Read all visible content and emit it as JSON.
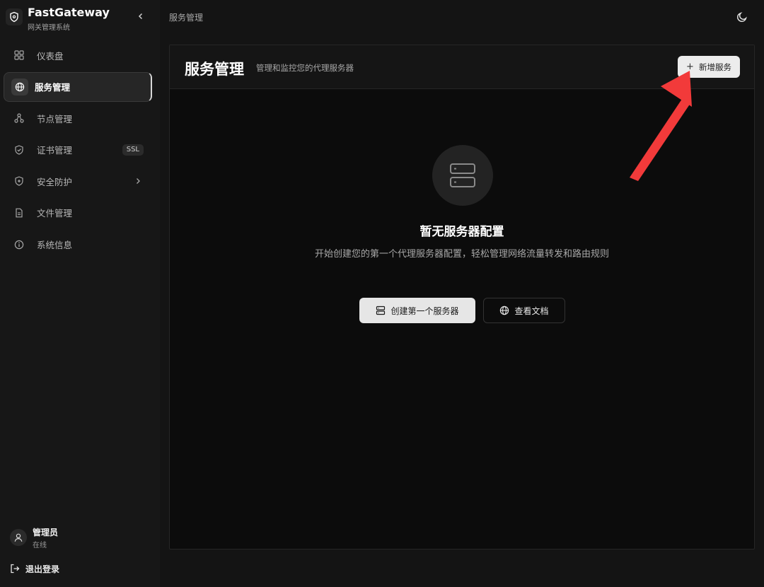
{
  "app": {
    "title": "FastGateway",
    "subtitle": "网关管理系统"
  },
  "sidebar": {
    "items": [
      {
        "label": "仪表盘",
        "icon": "dashboard-grid-icon"
      },
      {
        "label": "服务管理",
        "icon": "globe-icon",
        "active": true
      },
      {
        "label": "节点管理",
        "icon": "nodes-icon"
      },
      {
        "label": "证书管理",
        "icon": "shield-check-icon",
        "badge": "SSL"
      },
      {
        "label": "安全防护",
        "icon": "shield-plus-icon",
        "has_submenu": true
      },
      {
        "label": "文件管理",
        "icon": "file-icon"
      },
      {
        "label": "系统信息",
        "icon": "info-icon"
      }
    ]
  },
  "user": {
    "name": "管理员",
    "status": "在线"
  },
  "logout": {
    "label": "退出登录"
  },
  "header": {
    "breadcrumb": "服务管理",
    "theme_icon": "moon-icon"
  },
  "main": {
    "title": "服务管理",
    "description": "管理和监控您的代理服务器",
    "add_button": "新增服务",
    "empty": {
      "title": "暂无服务器配置",
      "description": "开始创建您的第一个代理服务器配置，轻松管理网络流量转发和路由规则",
      "primary_button": "创建第一个服务器",
      "secondary_button": "查看文档"
    }
  },
  "colors": {
    "background": "#141414",
    "panel": "#0c0c0c",
    "button_light": "#ececec",
    "annotation_arrow": "#f23a3a"
  }
}
